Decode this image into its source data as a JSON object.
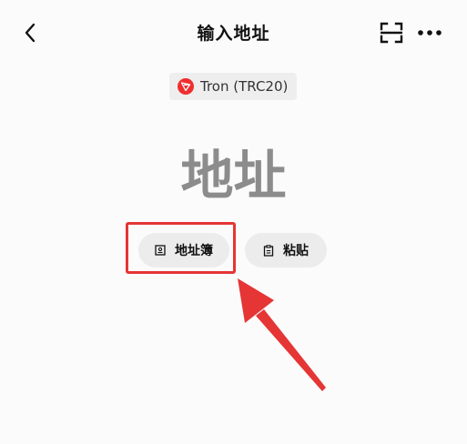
{
  "header": {
    "title": "输入地址",
    "back_icon": "chevron-left-icon",
    "scan_icon": "scan-icon",
    "more_icon": "more-horizontal-icon"
  },
  "network": {
    "label": "Tron (TRC20)",
    "icon": "tron-logo-icon",
    "icon_color": "#ef2f2f"
  },
  "address": {
    "placeholder": "地址",
    "value": ""
  },
  "actions": {
    "address_book_label": "地址簿",
    "address_book_icon": "address-book-icon",
    "paste_label": "粘贴",
    "paste_icon": "clipboard-icon"
  },
  "annotation": {
    "highlight_color": "#e53535"
  }
}
